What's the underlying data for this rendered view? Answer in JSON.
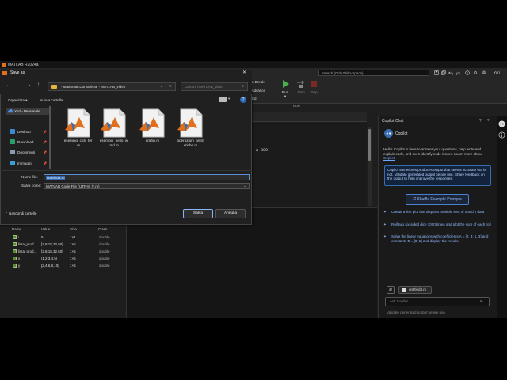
{
  "matlab": {
    "title": "MATLAB R2024a",
    "search_placeholder": "Search (Ctrl+Shift+Space)",
    "user": "Yuri",
    "toolstrip": {
      "breakpoint_items": [
        "n Break",
        "d Advance",
        "Ed"
      ],
      "run_label": "Run",
      "step_label": "Step",
      "stop_label": "Stop",
      "section_label": "RUN"
    },
    "editor_code_fragment": "a 300"
  },
  "workspace": {
    "columns": [
      "Name",
      "Value",
      "Size",
      "Class"
    ],
    "rows": [
      {
        "name": "i",
        "value": "5",
        "size": "1×1",
        "class": "double"
      },
      {
        "name": "lista_prod...",
        "value": "[2,8,18,32,50]",
        "size": "1×5",
        "class": "double"
      },
      {
        "name": "lista_prod...",
        "value": "[2,8,18,32,50]",
        "size": "1×5",
        "class": "double"
      },
      {
        "name": "x",
        "value": "[1,2,3,4,5]",
        "size": "1×5",
        "class": "double"
      },
      {
        "name": "y",
        "value": "[2,4,6,8,10]",
        "size": "1×5",
        "class": "double"
      }
    ]
  },
  "copilot": {
    "panel_title": "Copilot Chat",
    "name": "Copilot",
    "intro": "Hello! Copilot is here to answer your questions, help write and explain code, and even identify code issues. Learn more about",
    "intro_link": "Copilot",
    "notice": "Copilot sometimes produces output that seems accurate but is not. Validate generated output before use. Share feedback on the output to help improve the responses.",
    "shuffle_label": "Shuffle Example Prompts",
    "suggestions": [
      "Create a line plot that displays multiple sets of x and y data",
      "Roll two six-sided dice 1000 times and plot the sum of each roll",
      "Solve the linear equations with coefficients A = [2, 4; 1, 3] and constants B = [8; 5] and display the results"
    ],
    "attached_file": "untitled3.m",
    "input_placeholder": "Ask Copilot",
    "footer": "Validate generated output before use."
  },
  "dialog": {
    "title": "Save as",
    "breadcrumb": [
      "MatematicConsulente",
      "MATLAB_video"
    ],
    "search_placeholder": "Cerca in MATLAB_video",
    "organize_label": "Organizza",
    "new_folder_label": "Nuova cartella",
    "sidebar": [
      {
        "label": "Yuri - Personale",
        "icon": "cloud-icon"
      },
      {
        "label": "Desktop",
        "icon": "desktop-icon"
      },
      {
        "label": "Download",
        "icon": "download-icon"
      },
      {
        "label": "Documenti",
        "icon": "documents-icon"
      },
      {
        "label": "Immagini",
        "icon": "images-icon"
      }
    ],
    "files": [
      {
        "line1": "esempio_cicli_for",
        "line2": ".m"
      },
      {
        "line1": "esempio_hello_w",
        "line2": "orld.m"
      },
      {
        "line1": "grafici.m",
        "line2": ""
      },
      {
        "line1": "operazioni_aritm",
        "line2": "etiche.m"
      }
    ],
    "filename_label": "Nome file:",
    "filename_value": "untitled3.m",
    "filetype_label": "Salva come:",
    "filetype_value": "MATLAB Code File (UTF-8) (*.m)",
    "hide_folders_label": "Nascondi cartelle",
    "save_label": "Salva",
    "cancel_label": "Annulla"
  },
  "colors": {
    "accent": "#2f67b5",
    "copilot_link": "#8fb8ff",
    "run_green": "#4caf50",
    "stop_red": "#c0392b"
  }
}
